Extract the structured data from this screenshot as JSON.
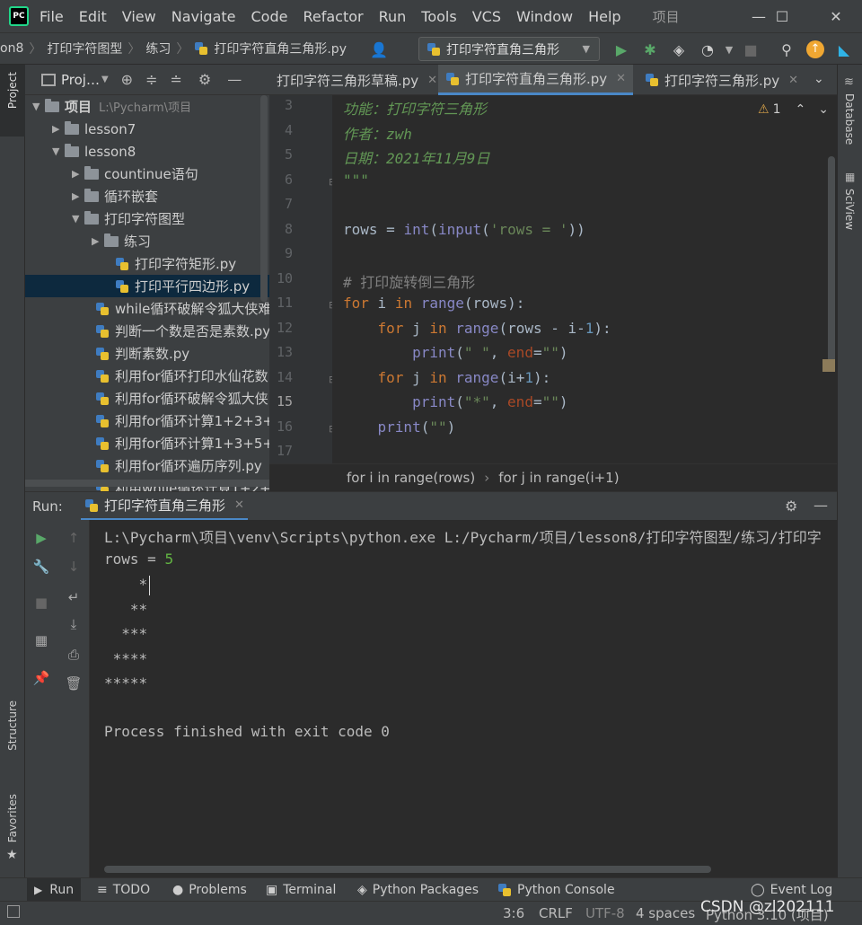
{
  "menubar": {
    "logo_text": "PC",
    "items": [
      "File",
      "Edit",
      "View",
      "Navigate",
      "Code",
      "Refactor",
      "Run",
      "Tools",
      "VCS",
      "Window",
      "Help"
    ],
    "window_title": "项目",
    "minimize": "—",
    "maximize": "☐",
    "close": "✕"
  },
  "navbar": {
    "crumbs": [
      "on8",
      "打印字符图型",
      "练习",
      "打印字符直角三角形.py"
    ],
    "run_config": "打印字符直角三角形"
  },
  "left_stripe": {
    "project": "Project",
    "structure": "Structure",
    "favorites": "Favorites"
  },
  "right_stripe": {
    "database": "Database",
    "sciview": "SciView"
  },
  "project": {
    "header": "Proj…",
    "tree": [
      {
        "label": "项目",
        "path": "L:\\Pycharm\\项目",
        "type": "folder",
        "expanded": true
      },
      {
        "label": "lesson7",
        "type": "folder",
        "expanded": false
      },
      {
        "label": "lesson8",
        "type": "folder",
        "expanded": true
      },
      {
        "label": "countinue语句",
        "type": "folder",
        "expanded": false
      },
      {
        "label": "循环嵌套",
        "type": "folder",
        "expanded": false
      },
      {
        "label": "打印字符图型",
        "type": "folder",
        "expanded": true
      },
      {
        "label": "练习",
        "type": "folder",
        "expanded": false
      },
      {
        "label": "打印字符矩形.py",
        "type": "file"
      },
      {
        "label": "打印平行四边形.py",
        "type": "file",
        "selected": true
      },
      {
        "label": "while循环破解令狐大侠难",
        "type": "file"
      },
      {
        "label": "判断一个数是否是素数.py",
        "type": "file"
      },
      {
        "label": "判断素数.py",
        "type": "file"
      },
      {
        "label": "利用for循环打印水仙花数.",
        "type": "file"
      },
      {
        "label": "利用for循环破解令狐大侠",
        "type": "file"
      },
      {
        "label": "利用for循环计算1+2+3+.",
        "type": "file"
      },
      {
        "label": "利用for循环计算1+3+5+.",
        "type": "file"
      },
      {
        "label": "利用for循环遍历序列.py",
        "type": "file"
      },
      {
        "label": "利用while循环计算1+2+3",
        "type": "file"
      }
    ]
  },
  "editor": {
    "tabs": [
      {
        "label": "打印字符三角形草稿.py",
        "active": false
      },
      {
        "label": "打印字符直角三角形.py",
        "active": true
      },
      {
        "label": "打印字符三角形.py",
        "active": false
      }
    ],
    "warning_count": "1",
    "line_numbers": [
      "3",
      "4",
      "5",
      "6",
      "7",
      "8",
      "9",
      "10",
      "11",
      "12",
      "13",
      "14",
      "15",
      "16",
      "17"
    ],
    "code": {
      "l3": "功能：打印字符三角形",
      "l4": "作者：zwh",
      "l5": "日期：2021年11月9日",
      "l6": "\"\"\"",
      "l8_var": "rows = ",
      "l8_int": "int",
      "l8_input": "input",
      "l8_str": "'rows = '",
      "l10": "# 打印旋转倒三角形",
      "l11_kw1": "for",
      "l11_var": "i",
      "l11_kw2": "in",
      "l11_fn": "range",
      "l11_arg": "(rows):",
      "l12_kw1": "for",
      "l12_var": "j",
      "l12_kw2": "in",
      "l12_fn": "range",
      "l12_arg": "(rows - i-",
      "l12_num": "1",
      "l12_end": "):",
      "l13_fn": "print",
      "l13_str": "\" \"",
      "l13_param": "end",
      "l13_str2": "\"\"",
      "l14_kw1": "for",
      "l14_var": "j",
      "l14_kw2": "in",
      "l14_fn": "range",
      "l14_arg": "(i+",
      "l14_num": "1",
      "l14_end": "):",
      "l15_fn": "print",
      "l15_str": "\"*\"",
      "l15_param": "end",
      "l15_str2": "\"\"",
      "l16_fn": "print",
      "l16_str": "\"\""
    },
    "breadcrumb": [
      "for i in range(rows)",
      "for j in range(i+1)"
    ]
  },
  "run": {
    "label": "Run:",
    "tab": "打印字符直角三角形",
    "console": [
      "L:\\Pycharm\\项目\\venv\\Scripts\\python.exe L:/Pycharm/项目/lesson8/打印字符图型/练习/打印字",
      "rows = ",
      "    *",
      "   **",
      "  ***",
      " ****",
      "*****",
      "",
      "Process finished with exit code 0"
    ],
    "input_value": "5"
  },
  "bottom_tools": [
    "Run",
    "TODO",
    "Problems",
    "Terminal",
    "Python Packages",
    "Python Console",
    "Event Log"
  ],
  "status": {
    "position": "3:6",
    "line_sep": "CRLF",
    "encoding": "UTF-8",
    "indent": "4 spaces",
    "interpreter": "Python 3.10 (项目)"
  },
  "watermark": "CSDN @zl202111"
}
